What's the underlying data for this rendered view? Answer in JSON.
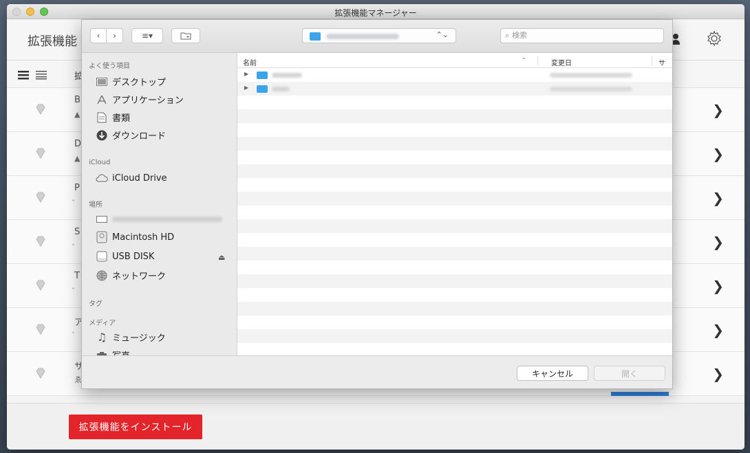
{
  "window": {
    "title": "拡張機能マネージャー"
  },
  "app": {
    "heading": "拡張機能",
    "list_header": "拡",
    "rows": [
      {
        "letter": "B",
        "sub": "▲"
      },
      {
        "letter": "D",
        "sub": "▲"
      },
      {
        "letter": "P",
        "sub": "゙"
      },
      {
        "letter": "S",
        "sub": "゙"
      },
      {
        "letter": "T",
        "sub": "゙"
      },
      {
        "letter": "ア",
        "sub": "゙"
      },
      {
        "letter": "サ",
        "sub": "ゑ"
      }
    ],
    "install_label": "拡張機能をインストール"
  },
  "dialog": {
    "search_placeholder": "検索",
    "columns": {
      "name": "名前",
      "date": "変更日",
      "size": "サ"
    },
    "sidebar": {
      "favorites_title": "よく使う項目",
      "favorites": [
        "デスクトップ",
        "アプリケーション",
        "書類",
        "ダウンロード"
      ],
      "icloud_title": "iCloud",
      "icloud_drive": "iCloud Drive",
      "places_title": "場所",
      "macintosh_hd": "Macintosh HD",
      "usb_disk": "USB DISK",
      "network": "ネットワーク",
      "tags_title": "タグ",
      "media_title": "メディア",
      "music": "ミュージック",
      "photos": "写真"
    },
    "cancel_label": "キャンセル",
    "open_label": "開く"
  },
  "colors": {
    "accent_red": "#e3242b",
    "folder_blue": "#3da4ec"
  }
}
